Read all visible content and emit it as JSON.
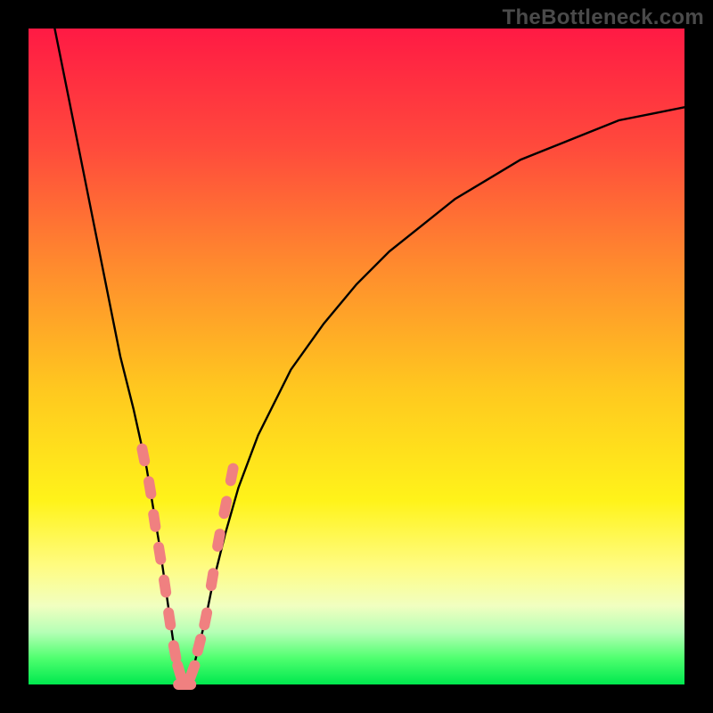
{
  "watermark": "TheBottleneck.com",
  "colors": {
    "background": "#000000",
    "gradient_top": "#ff1a44",
    "gradient_bottom": "#00e84e",
    "curve": "#000000",
    "marker": "#f08080"
  },
  "chart_data": {
    "type": "line",
    "title": "",
    "xlabel": "",
    "ylabel": "",
    "xlim": [
      0,
      100
    ],
    "ylim": [
      0,
      100
    ],
    "grid": false,
    "legend": false,
    "series": [
      {
        "name": "bottleneck-curve",
        "x": [
          4,
          6,
          8,
          10,
          12,
          14,
          16,
          18,
          19,
          20,
          21,
          22,
          23,
          24,
          25,
          26,
          27,
          28,
          30,
          32,
          35,
          40,
          45,
          50,
          55,
          60,
          65,
          70,
          75,
          80,
          85,
          90,
          95,
          100
        ],
        "y": [
          100,
          90,
          80,
          70,
          60,
          50,
          42,
          33,
          27,
          21,
          14,
          7,
          2,
          0,
          2,
          6,
          10,
          15,
          23,
          30,
          38,
          48,
          55,
          61,
          66,
          70,
          74,
          77,
          80,
          82,
          84,
          86,
          87,
          88
        ]
      }
    ],
    "markers": {
      "name": "highlighted-points",
      "x": [
        17.5,
        18.5,
        19.2,
        20.0,
        20.8,
        21.5,
        22.3,
        23.0,
        23.8,
        25.0,
        26.0,
        27.0,
        28.0,
        29.0,
        30.0,
        31.0
      ],
      "y": [
        35,
        30,
        25,
        20,
        15,
        10,
        5,
        2,
        0,
        2,
        6,
        10,
        16,
        22,
        27,
        32
      ]
    }
  }
}
